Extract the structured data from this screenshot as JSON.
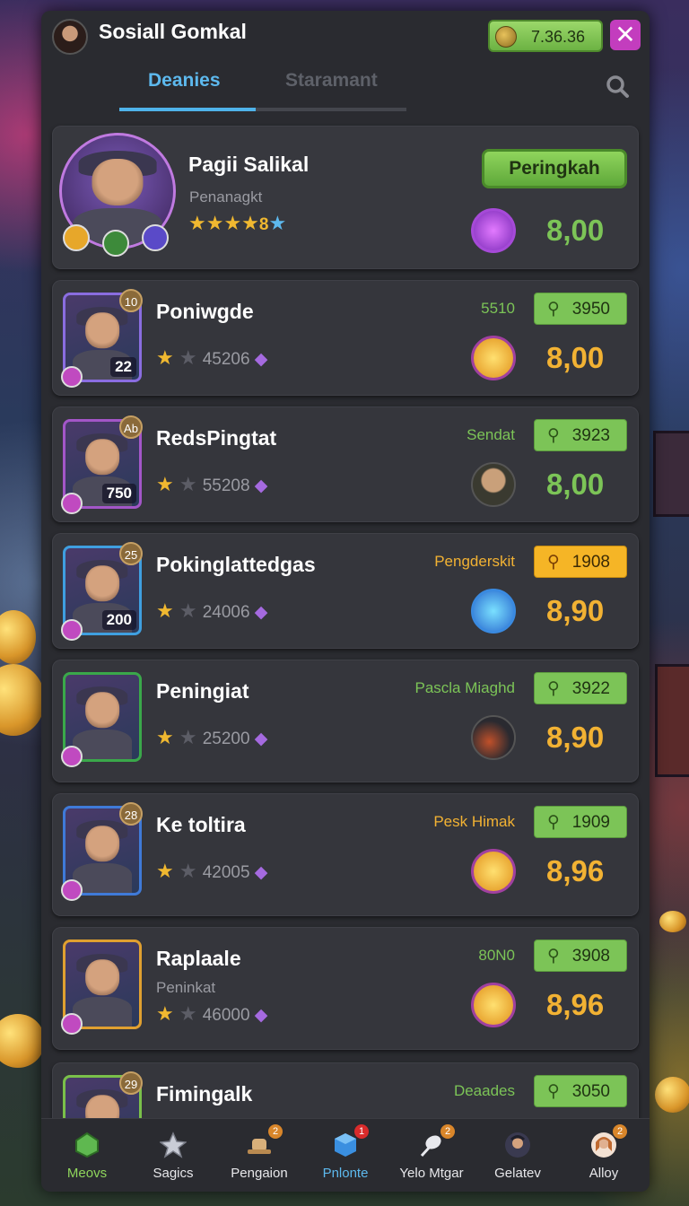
{
  "header": {
    "title": "Sosiall Gomkal",
    "currency_value": "7.36.36",
    "close_label": "✕"
  },
  "tabs": [
    {
      "label": "Deanies",
      "active": true
    },
    {
      "label": "Staramant",
      "active": false
    }
  ],
  "featured": {
    "name": "Pagii Salikal",
    "subtitle": "Penanagkt",
    "stars": "★★★★",
    "star_count": "8",
    "button_label": "Peringkah",
    "amount": "8,00"
  },
  "rows": [
    {
      "name": "Poniwgde",
      "badge": "10",
      "level": "22",
      "stats_value": "45206",
      "tag": "5510",
      "price": "3950",
      "amount": "8,00",
      "amount_color": "gold",
      "tag_color": "#7cc457",
      "orb": "star"
    },
    {
      "name": "RedsPingtat",
      "badge": "Ab",
      "level": "750",
      "stats_value": "55208",
      "tag": "Sendat",
      "price": "3923",
      "amount": "8,00",
      "amount_color": "green",
      "tag_color": "#7cc457",
      "orb": "portrait"
    },
    {
      "name": "Pokinglattedgas",
      "badge": "25",
      "level": "200",
      "stats_value": "24006",
      "tag": "Pengderskit",
      "price": "1908",
      "amount": "8,90",
      "amount_color": "gold",
      "tag_color": "#f2b233",
      "orb": "blue",
      "gold_badge": true
    },
    {
      "name": "Peningiat",
      "badge": "",
      "level": "",
      "stats_value": "25200",
      "tag": "Pascla Miaghd",
      "price": "3922",
      "amount": "8,90",
      "amount_color": "gold",
      "tag_color": "#7cc457",
      "orb": "feather"
    },
    {
      "name": "Ke toltira",
      "badge": "28",
      "level": "",
      "stats_value": "42005",
      "tag": "Pesk Himak",
      "price": "1909",
      "amount": "8,96",
      "amount_color": "gold",
      "tag_color": "#f2b233",
      "orb": "star"
    },
    {
      "name": "Raplaale",
      "subtitle": "Peninkat",
      "badge": "",
      "level": "",
      "stats_value": "46000",
      "tag": "80N0",
      "price": "3908",
      "amount": "8,96",
      "amount_color": "gold",
      "tag_color": "#7cc457",
      "orb": "star"
    },
    {
      "name": "Fimingalk",
      "badge": "29",
      "level": "",
      "stats_value": "",
      "tag": "Deaades",
      "price": "3050",
      "amount": "",
      "amount_color": "gold",
      "tag_color": "#7cc457",
      "orb": ""
    }
  ],
  "nav": [
    {
      "label": "Meovs",
      "icon": "gem-icon"
    },
    {
      "label": "Sagics",
      "icon": "star-icon"
    },
    {
      "label": "Pengaion",
      "icon": "hat-icon",
      "badge": "2"
    },
    {
      "label": "Pnlonte",
      "icon": "cube-icon",
      "badge": "1"
    },
    {
      "label": "Yelo Mtgar",
      "icon": "feather-icon",
      "badge": "2"
    },
    {
      "label": "Gelatev",
      "icon": "character-icon"
    },
    {
      "label": "Alloy",
      "icon": "profile-icon",
      "badge": "2"
    }
  ],
  "colors": {
    "accent_green": "#7cc457",
    "accent_gold": "#f2b233",
    "tab_active": "#4fb3ea",
    "close": "#c33dbe"
  }
}
